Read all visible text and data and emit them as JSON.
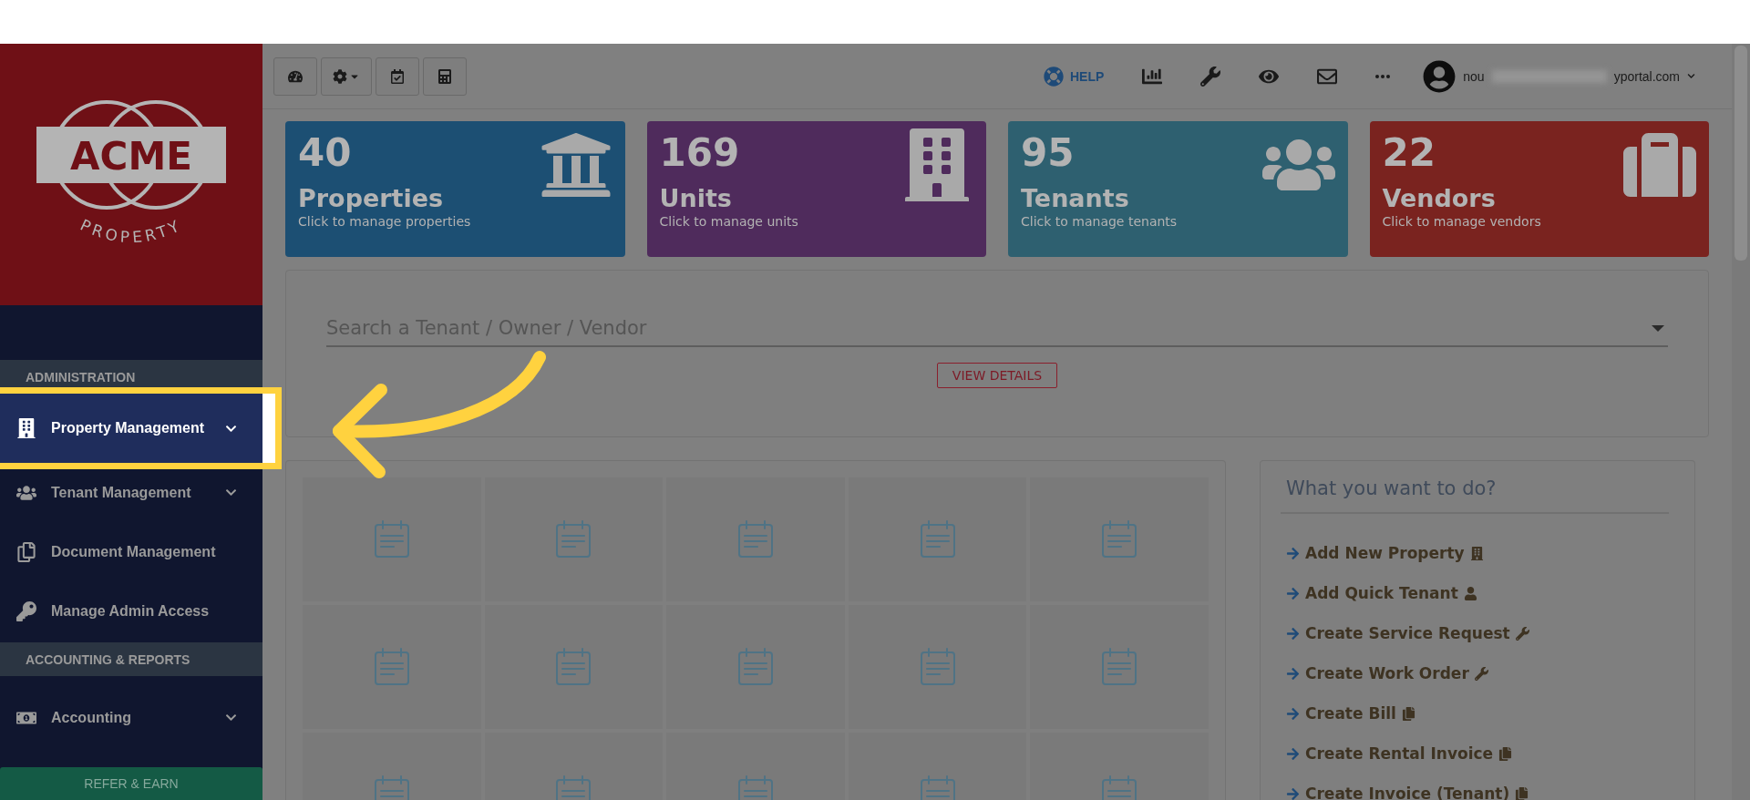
{
  "sidebar": {
    "logo": {
      "name": "ACME",
      "tagline": "PROPERTY"
    },
    "sections": [
      {
        "title": "ADMINISTRATION",
        "items": [
          {
            "label": "Property Management",
            "kind": "building",
            "expandable": true,
            "highlighted": true
          },
          {
            "label": "Tenant Management",
            "kind": "users",
            "expandable": true,
            "highlighted": false
          },
          {
            "label": "Document Management",
            "kind": "documents",
            "expandable": false,
            "highlighted": false
          },
          {
            "label": "Manage Admin Access",
            "kind": "key",
            "expandable": false,
            "highlighted": false
          }
        ]
      },
      {
        "title": "ACCOUNTING & REPORTS",
        "items": [
          {
            "label": "Accounting",
            "kind": "money",
            "expandable": true,
            "highlighted": false
          }
        ]
      }
    ],
    "refer": "REFER & EARN"
  },
  "toolbar": {
    "buttons": [
      {
        "kind": "dashboard"
      },
      {
        "kind": "settings"
      },
      {
        "kind": "calendar"
      },
      {
        "kind": "calculator"
      }
    ]
  },
  "header": {
    "help": "HELP",
    "icons": [
      {
        "kind": "chart"
      },
      {
        "kind": "wrench"
      },
      {
        "kind": "eye"
      },
      {
        "kind": "mail"
      },
      {
        "kind": "more"
      }
    ],
    "email_start": "nou",
    "email_end": "yportal.com"
  },
  "stats": [
    {
      "value": "40",
      "label": "Properties",
      "caption": "Click to manage properties",
      "color": "#1c4f73",
      "kind": "bank"
    },
    {
      "value": "169",
      "label": "Units",
      "caption": "Click to manage units",
      "color": "#4f2b5c",
      "kind": "tower"
    },
    {
      "value": "95",
      "label": "Tenants",
      "caption": "Click to manage tenants",
      "color": "#2e6070",
      "kind": "users"
    },
    {
      "value": "22",
      "label": "Vendors",
      "caption": "Click to manage vendors",
      "color": "#7a231f",
      "kind": "suitcase"
    }
  ],
  "search": {
    "placeholder": "Search a Tenant / Owner / Vendor",
    "button": "VIEW DETAILS"
  },
  "tiles": [
    {
      "kind": "notepad"
    },
    {
      "kind": "notepad"
    },
    {
      "kind": "notepad"
    },
    {
      "kind": "notepad"
    },
    {
      "kind": "notepad"
    },
    {
      "kind": "notepad"
    },
    {
      "kind": "notepad"
    },
    {
      "kind": "notepad"
    },
    {
      "kind": "notepad"
    },
    {
      "kind": "notepad"
    },
    {
      "kind": "notepad"
    },
    {
      "kind": "notepad"
    },
    {
      "kind": "notepad"
    },
    {
      "kind": "notepad"
    },
    {
      "kind": "notepad"
    }
  ],
  "actions": {
    "title": "What you want to do?",
    "links": [
      {
        "label": "Add New Property",
        "kind": "building"
      },
      {
        "label": "Add Quick Tenant",
        "kind": "user"
      },
      {
        "label": "Create Service Request",
        "kind": "wrench"
      },
      {
        "label": "Create Work Order",
        "kind": "wrench"
      },
      {
        "label": "Create Bill",
        "kind": "copy"
      },
      {
        "label": "Create Rental Invoice",
        "kind": "copy"
      },
      {
        "label": "Create Invoice (Tenant)",
        "kind": "copy"
      }
    ]
  }
}
